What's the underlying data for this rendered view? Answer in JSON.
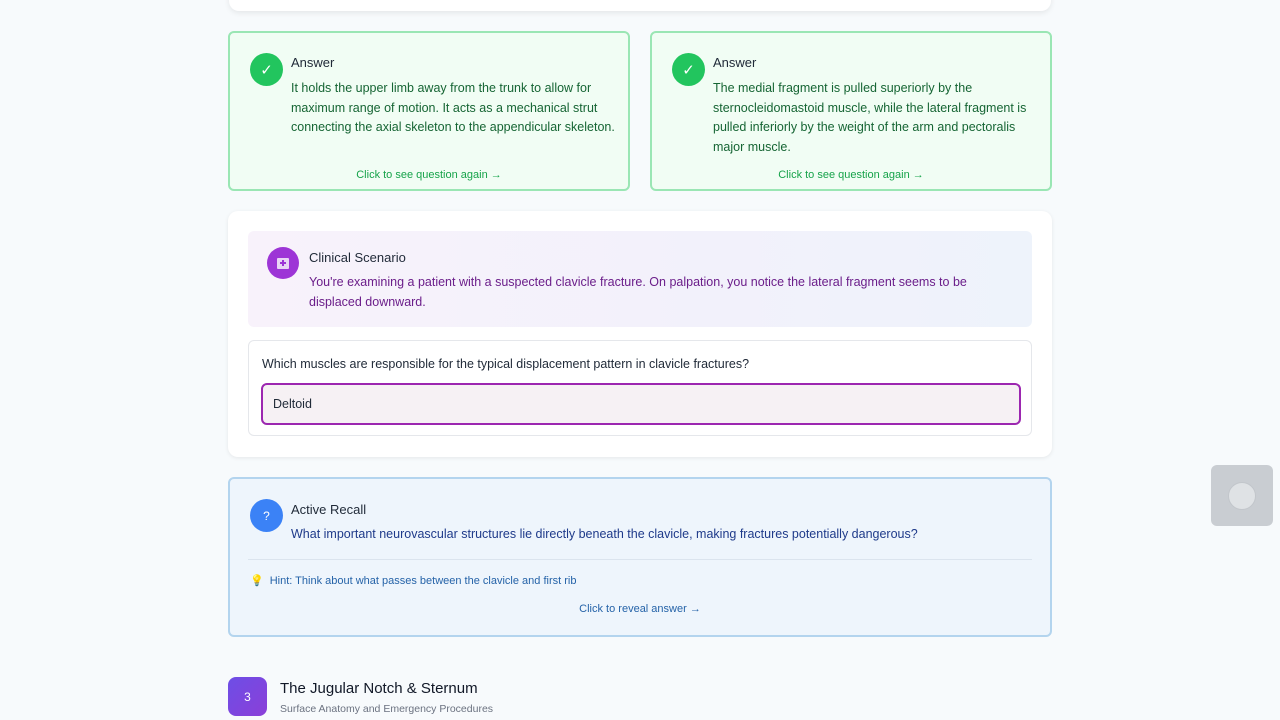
{
  "answer_cards": [
    {
      "title": "Answer",
      "text": "It holds the upper limb away from the trunk to allow for maximum range of motion. It acts as a mechanical strut connecting the axial skeleton to the appendicular skeleton.",
      "link": "Click to see question again →",
      "icon": "check-icon"
    },
    {
      "title": "Answer",
      "text": "The medial fragment is pulled superiorly by the sternocleidomastoid muscle, while the lateral fragment is pulled inferiorly by the weight of the arm and pectoralis major muscle.",
      "link": "Click to see question again →",
      "icon": "check-icon"
    }
  ],
  "scenario": {
    "title": "Clinical Scenario",
    "text": "You're examining a patient with a suspected clavicle fracture. On palpation, you notice the lateral fragment seems to be displaced downward.",
    "icon": "hospital-icon",
    "question": "Which muscles are responsible for the typical displacement pattern in clavicle fractures?",
    "input_value": "Deltoid"
  },
  "recall": {
    "title": "Active Recall",
    "question": "What important neurovascular structures lie directly beneath the clavicle, making fractures potentially dangerous?",
    "hint": "Hint: Think about what passes between the clavicle and first rib",
    "hint_icon": "lightbulb-icon",
    "reveal": "Click to reveal answer →",
    "icon_glyph": "?"
  },
  "next_section": {
    "number": "3",
    "title": "The Jugular Notch & Sternum",
    "subtitle": "Surface Anatomy and Emergency Procedures"
  },
  "colors": {
    "answer_green": "#22c55e",
    "scenario_purple": "#9d35d6",
    "recall_blue": "#3b82f6",
    "input_border": "#9c27b0"
  }
}
